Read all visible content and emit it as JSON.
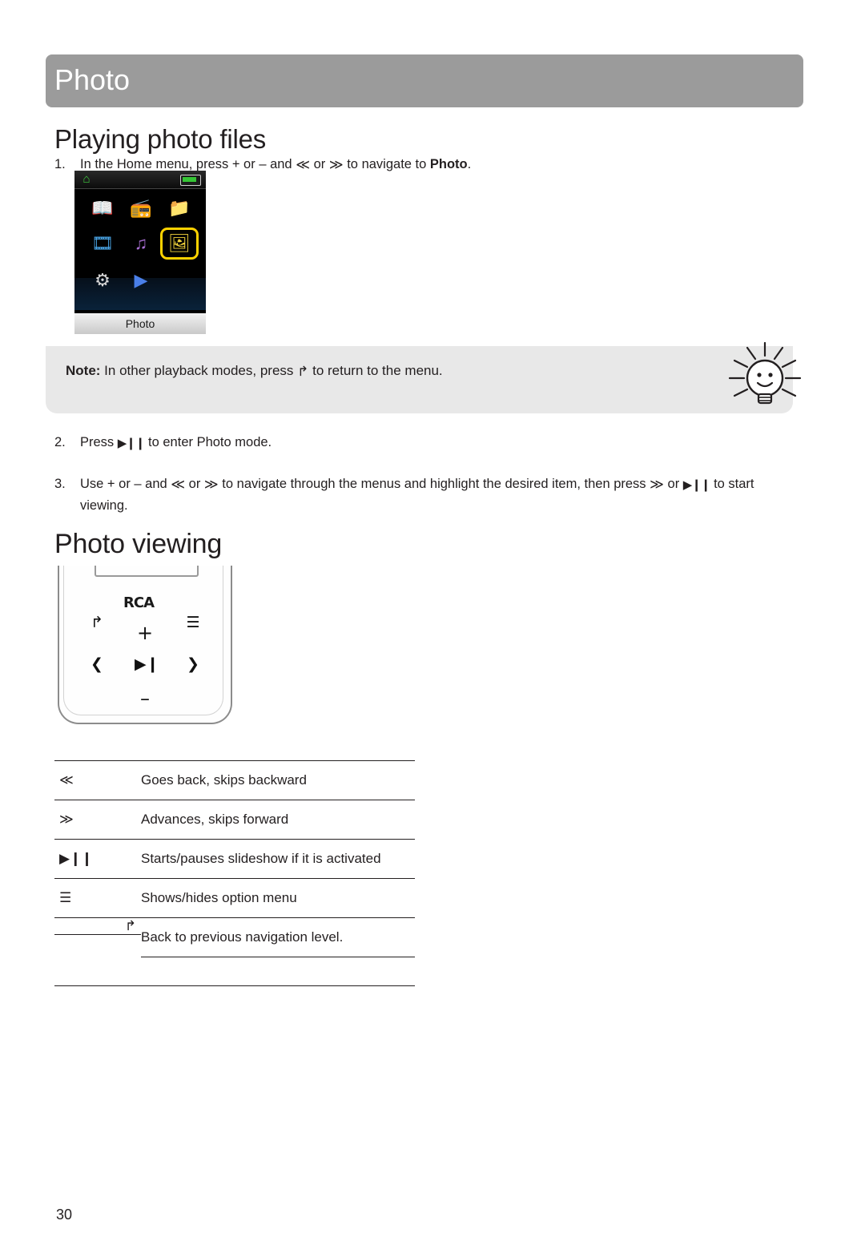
{
  "header": {
    "title": "Photo"
  },
  "headings": {
    "playing": "Playing photo files",
    "viewing": "Photo viewing"
  },
  "steps": [
    {
      "number": "1.",
      "text_parts": {
        "a": "In the Home menu, press + or – and ",
        "prev": "≪",
        "b": " or ",
        "next": "≫",
        "c": " to navigate to ",
        "bold": "Photo",
        "d": "."
      }
    },
    {
      "number": "2.",
      "text_parts": {
        "a": "Press ",
        "play": "▶❙❙",
        "b": " to enter Photo mode."
      }
    },
    {
      "number": "3.",
      "text_parts": {
        "a": "Use + or – and ",
        "prev": "≪",
        "b": " or ",
        "next": "≫",
        "c": " to navigate through the menus and highlight the desired item, then press ",
        "next2": "≫",
        "d": " or ",
        "play": "▶❙❙",
        "e": " to start viewing."
      }
    }
  ],
  "device_screen": {
    "home_icon": "⌂",
    "label": "Photo",
    "icons": [
      {
        "name": "ebook-icon",
        "glyph": "📖",
        "color": "#f2a33c"
      },
      {
        "name": "radio-icon",
        "glyph": "📻",
        "color": "#3fb5a8"
      },
      {
        "name": "folder-icon",
        "glyph": "📁",
        "color": "#e4443b"
      },
      {
        "name": "video-icon",
        "glyph": "🎞",
        "color": "#4aa6e8"
      },
      {
        "name": "music-icon",
        "glyph": "♫",
        "color": "#a96fd4"
      },
      {
        "name": "photo-icon",
        "glyph": "🖼",
        "color": "#f2d33c"
      },
      {
        "name": "settings-icon",
        "glyph": "⚙",
        "color": "#d0d0d0"
      },
      {
        "name": "now-playing-icon",
        "glyph": "▶",
        "color": "#4a7fe8"
      }
    ]
  },
  "note": {
    "label": "Note:",
    "text_a": " In other playback modes, press ",
    "back_glyph": "↰",
    "text_b": " to return to the menu."
  },
  "player": {
    "brand": "RCA",
    "keys": {
      "back": "↰",
      "menu": "☰",
      "plus": "+",
      "left": "❮",
      "play": "▶❙",
      "right": "❯",
      "minus": "–"
    }
  },
  "key_table": {
    "rows": [
      {
        "icon": "≪",
        "icon_name": "skip-backward-icon",
        "description": "Goes back, skips backward"
      },
      {
        "icon": "≫",
        "icon_name": "skip-forward-icon",
        "description": "Advances, skips forward"
      },
      {
        "icon": "▶❙❙",
        "icon_name": "play-pause-icon",
        "description": "Starts/pauses slideshow if it is activated"
      },
      {
        "icon": "☰",
        "icon_name": "option-menu-icon",
        "description": "Shows/hides option menu"
      },
      {
        "icon": "↰",
        "icon_name": "back-icon",
        "description": "Back to previous navigation level."
      }
    ]
  },
  "footer": {
    "page_number": "30"
  }
}
